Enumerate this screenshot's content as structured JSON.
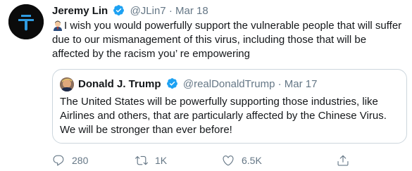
{
  "tweet": {
    "author_name": "Jeremy Lin",
    "author_handle": "@JLin7",
    "separator": "·",
    "date": "Mar 18",
    "text": "I wish you would powerfully support the vulnerable people that will suffer due to our mismanagement of this virus, including those that will be affected by the racism you’ re empowering"
  },
  "quoted_tweet": {
    "author_name": "Donald J. Trump",
    "author_handle": "@realDonaldTrump",
    "separator": "·",
    "date": "Mar 17",
    "text": "The United States will be powerfully supporting those industries, like Airlines and others, that are particularly affected by the Chinese Virus. We will be stronger than ever before!"
  },
  "actions": {
    "reply_count": "280",
    "retweet_count": "1K",
    "like_count": "6.5K"
  },
  "icons": [
    "avatar-logo-icon",
    "verified-icon",
    "emoji-icon",
    "reply-icon",
    "retweet-icon",
    "like-icon",
    "share-icon"
  ],
  "colors": {
    "verified": "#1da1f2",
    "secondary_text": "#657786",
    "border": "#ccd6dd"
  }
}
